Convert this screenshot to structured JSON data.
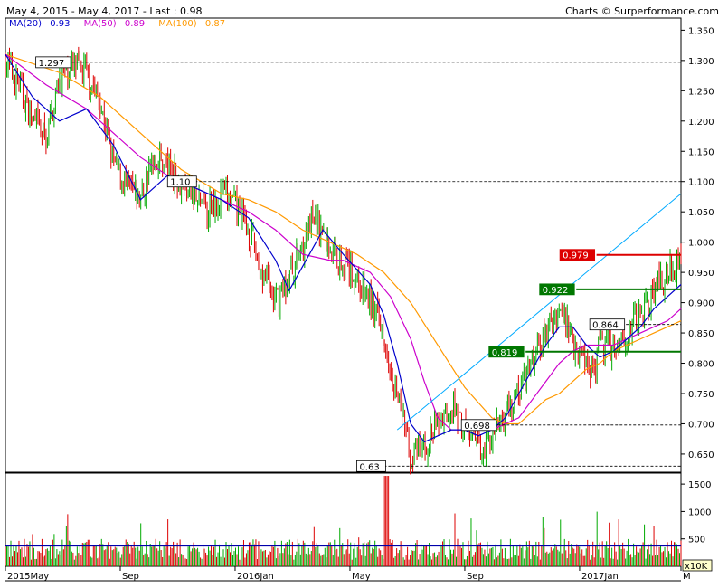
{
  "header": {
    "range_text": "May 4, 2015 - May 4, 2017 - Last : 0.98",
    "credit": "Charts © Surperformance.com"
  },
  "legend": [
    {
      "label": "MA(20)",
      "value": "0.93",
      "color": "#0000cc"
    },
    {
      "label": "MA(50)",
      "value": "0.89",
      "color": "#cc00cc"
    },
    {
      "label": "MA(100)",
      "value": "0.87",
      "color": "#ff9900"
    }
  ],
  "colors": {
    "up": "#00aa00",
    "down": "#dd0000",
    "trendline": "#00aaff",
    "grid": "#000000",
    "vol_ma": "#0000aa"
  },
  "chart_data": {
    "type": "candlestick",
    "title": "May 4, 2015 - May 4, 2017 - Last : 0.98",
    "y_ticks": [
      "1.350",
      "1.300",
      "1.250",
      "1.200",
      "1.150",
      "1.100",
      "1.050",
      "1.000",
      "0.950",
      "0.900",
      "0.850",
      "0.800",
      "0.750",
      "0.700",
      "0.650"
    ],
    "ylim": [
      0.62,
      1.37
    ],
    "x_ticks": [
      "2015May",
      "Sep",
      "2016Jan",
      "May",
      "Sep",
      "2017Jan",
      "M"
    ],
    "x_tick_pos": [
      0,
      0.17,
      0.34,
      0.51,
      0.68,
      0.85,
      1.0
    ],
    "vol_ticks": [
      "1500",
      "1000",
      "500"
    ],
    "vol_unit": "x10K",
    "vol_ylim": [
      0,
      1700
    ],
    "levels": [
      {
        "label": "1.297",
        "value": 1.297,
        "style": "dashed",
        "tag": "white"
      },
      {
        "label": "1.10",
        "value": 1.1,
        "style": "dashed",
        "tag": "white"
      },
      {
        "label": "0.979",
        "value": 0.979,
        "style": "solid-red",
        "tag": "red"
      },
      {
        "label": "0.922",
        "value": 0.922,
        "style": "solid-green",
        "tag": "green"
      },
      {
        "label": "0.864",
        "value": 0.864,
        "style": "dashed",
        "tag": "white"
      },
      {
        "label": "0.819",
        "value": 0.819,
        "style": "solid-green",
        "tag": "green"
      },
      {
        "label": "0.698",
        "value": 0.698,
        "style": "dashed",
        "tag": "white"
      },
      {
        "label": "0.63",
        "value": 0.63,
        "style": "dashed",
        "tag": "white"
      }
    ],
    "price_path": [
      [
        0.0,
        1.3
      ],
      [
        0.02,
        1.26
      ],
      [
        0.04,
        1.2
      ],
      [
        0.06,
        1.17
      ],
      [
        0.08,
        1.27
      ],
      [
        0.1,
        1.29
      ],
      [
        0.12,
        1.28
      ],
      [
        0.14,
        1.23
      ],
      [
        0.16,
        1.13
      ],
      [
        0.18,
        1.09
      ],
      [
        0.2,
        1.07
      ],
      [
        0.22,
        1.14
      ],
      [
        0.24,
        1.13
      ],
      [
        0.26,
        1.1
      ],
      [
        0.28,
        1.07
      ],
      [
        0.3,
        1.06
      ],
      [
        0.32,
        1.08
      ],
      [
        0.34,
        1.06
      ],
      [
        0.36,
        1.02
      ],
      [
        0.38,
        0.95
      ],
      [
        0.4,
        0.9
      ],
      [
        0.42,
        0.94
      ],
      [
        0.44,
        1.0
      ],
      [
        0.46,
        1.04
      ],
      [
        0.48,
        0.99
      ],
      [
        0.5,
        0.97
      ],
      [
        0.52,
        0.94
      ],
      [
        0.54,
        0.9
      ],
      [
        0.56,
        0.85
      ],
      [
        0.58,
        0.75
      ],
      [
        0.59,
        0.7
      ],
      [
        0.6,
        0.64
      ],
      [
        0.62,
        0.66
      ],
      [
        0.64,
        0.7
      ],
      [
        0.66,
        0.73
      ],
      [
        0.68,
        0.69
      ],
      [
        0.7,
        0.66
      ],
      [
        0.72,
        0.68
      ],
      [
        0.74,
        0.72
      ],
      [
        0.76,
        0.75
      ],
      [
        0.78,
        0.8
      ],
      [
        0.8,
        0.85
      ],
      [
        0.82,
        0.89
      ],
      [
        0.83,
        0.87
      ],
      [
        0.85,
        0.82
      ],
      [
        0.87,
        0.79
      ],
      [
        0.88,
        0.83
      ],
      [
        0.9,
        0.83
      ],
      [
        0.92,
        0.85
      ],
      [
        0.94,
        0.88
      ],
      [
        0.96,
        0.92
      ],
      [
        0.98,
        0.95
      ],
      [
        1.0,
        0.98
      ]
    ],
    "ma20": [
      [
        0.0,
        1.31
      ],
      [
        0.04,
        1.24
      ],
      [
        0.08,
        1.2
      ],
      [
        0.12,
        1.22
      ],
      [
        0.16,
        1.16
      ],
      [
        0.2,
        1.07
      ],
      [
        0.24,
        1.11
      ],
      [
        0.28,
        1.09
      ],
      [
        0.32,
        1.07
      ],
      [
        0.36,
        1.04
      ],
      [
        0.4,
        0.97
      ],
      [
        0.42,
        0.92
      ],
      [
        0.45,
        0.98
      ],
      [
        0.47,
        1.02
      ],
      [
        0.5,
        0.98
      ],
      [
        0.54,
        0.93
      ],
      [
        0.56,
        0.88
      ],
      [
        0.58,
        0.8
      ],
      [
        0.6,
        0.7
      ],
      [
        0.62,
        0.67
      ],
      [
        0.64,
        0.68
      ],
      [
        0.66,
        0.69
      ],
      [
        0.68,
        0.69
      ],
      [
        0.7,
        0.68
      ],
      [
        0.72,
        0.69
      ],
      [
        0.74,
        0.71
      ],
      [
        0.76,
        0.75
      ],
      [
        0.78,
        0.79
      ],
      [
        0.8,
        0.83
      ],
      [
        0.82,
        0.86
      ],
      [
        0.84,
        0.86
      ],
      [
        0.86,
        0.83
      ],
      [
        0.88,
        0.81
      ],
      [
        0.9,
        0.82
      ],
      [
        0.92,
        0.84
      ],
      [
        0.94,
        0.86
      ],
      [
        0.96,
        0.89
      ],
      [
        0.98,
        0.91
      ],
      [
        1.0,
        0.93
      ]
    ],
    "ma50": [
      [
        0.0,
        1.31
      ],
      [
        0.06,
        1.26
      ],
      [
        0.12,
        1.22
      ],
      [
        0.16,
        1.18
      ],
      [
        0.2,
        1.14
      ],
      [
        0.24,
        1.11
      ],
      [
        0.28,
        1.09
      ],
      [
        0.32,
        1.07
      ],
      [
        0.36,
        1.05
      ],
      [
        0.4,
        1.02
      ],
      [
        0.44,
        0.98
      ],
      [
        0.48,
        0.97
      ],
      [
        0.5,
        0.97
      ],
      [
        0.54,
        0.95
      ],
      [
        0.57,
        0.91
      ],
      [
        0.6,
        0.84
      ],
      [
        0.62,
        0.77
      ],
      [
        0.64,
        0.71
      ],
      [
        0.66,
        0.69
      ],
      [
        0.68,
        0.69
      ],
      [
        0.7,
        0.69
      ],
      [
        0.72,
        0.69
      ],
      [
        0.74,
        0.7
      ],
      [
        0.76,
        0.71
      ],
      [
        0.78,
        0.74
      ],
      [
        0.8,
        0.77
      ],
      [
        0.82,
        0.8
      ],
      [
        0.84,
        0.82
      ],
      [
        0.86,
        0.83
      ],
      [
        0.88,
        0.83
      ],
      [
        0.9,
        0.83
      ],
      [
        0.92,
        0.84
      ],
      [
        0.94,
        0.85
      ],
      [
        0.96,
        0.86
      ],
      [
        0.98,
        0.87
      ],
      [
        1.0,
        0.89
      ]
    ],
    "ma100": [
      [
        0.0,
        1.31
      ],
      [
        0.08,
        1.28
      ],
      [
        0.14,
        1.24
      ],
      [
        0.2,
        1.18
      ],
      [
        0.26,
        1.12
      ],
      [
        0.32,
        1.08
      ],
      [
        0.36,
        1.07
      ],
      [
        0.4,
        1.05
      ],
      [
        0.44,
        1.02
      ],
      [
        0.48,
        1.0
      ],
      [
        0.52,
        0.98
      ],
      [
        0.56,
        0.95
      ],
      [
        0.6,
        0.9
      ],
      [
        0.64,
        0.83
      ],
      [
        0.68,
        0.76
      ],
      [
        0.72,
        0.71
      ],
      [
        0.74,
        0.7
      ],
      [
        0.76,
        0.7
      ],
      [
        0.78,
        0.72
      ],
      [
        0.8,
        0.74
      ],
      [
        0.82,
        0.75
      ],
      [
        0.84,
        0.77
      ],
      [
        0.86,
        0.79
      ],
      [
        0.88,
        0.8
      ],
      [
        0.9,
        0.82
      ],
      [
        0.92,
        0.83
      ],
      [
        0.94,
        0.84
      ],
      [
        0.96,
        0.85
      ],
      [
        1.0,
        0.87
      ]
    ],
    "trendline": [
      [
        0.58,
        0.69
      ],
      [
        1.0,
        1.08
      ]
    ],
    "vol_ma_level": 370
  }
}
